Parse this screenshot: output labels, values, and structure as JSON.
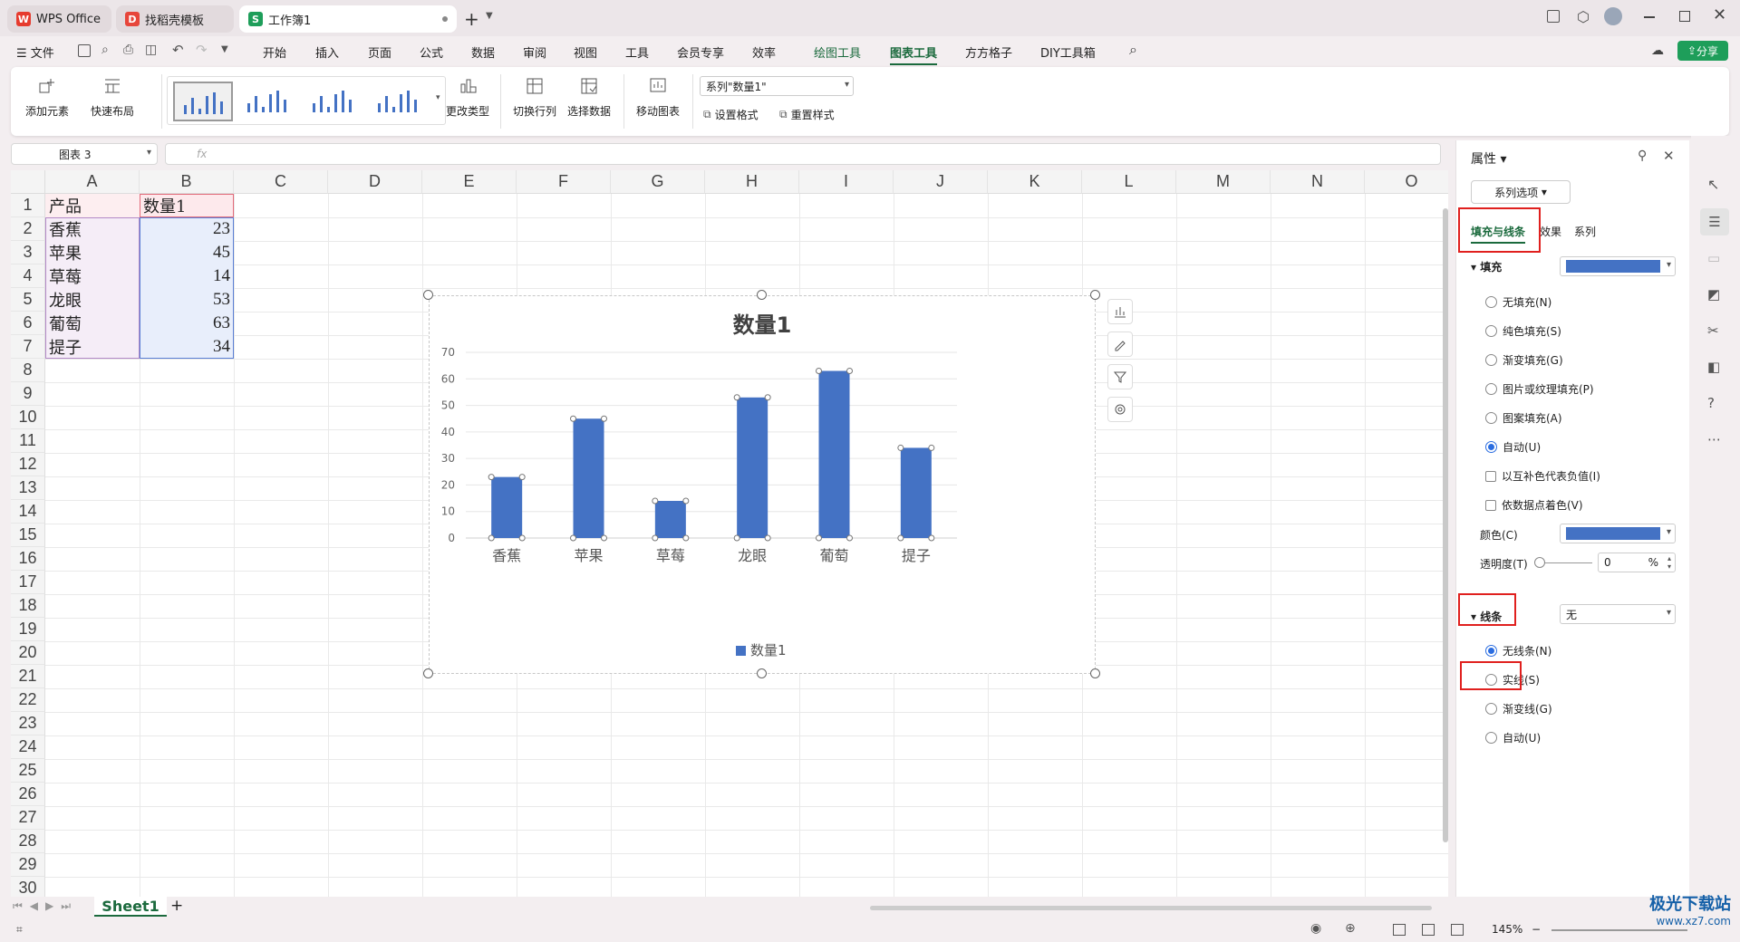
{
  "tabs": [
    {
      "label": "WPS Office",
      "logo": "W"
    },
    {
      "label": "找稻壳模板",
      "logo": "D"
    },
    {
      "label": "工作簿1",
      "logo": "S"
    }
  ],
  "menu": {
    "file": "文件",
    "items": [
      "开始",
      "插入",
      "页面",
      "公式",
      "数据",
      "审阅",
      "视图",
      "工具",
      "会员专享",
      "效率",
      "绘图工具",
      "图表工具",
      "方方格子",
      "DIY工具箱"
    ],
    "share": "分享"
  },
  "ribbon": {
    "add_element": "添加元素",
    "quick_layout": "快速布局",
    "change_type": "更改类型",
    "switch_row_col": "切换行列",
    "select_data": "选择数据",
    "move_chart": "移动图表",
    "series_select": "系列\"数量1\"",
    "set_format": "设置格式",
    "reset_style": "重置样式"
  },
  "name_box": "图表 3",
  "formula_fx": "fx",
  "columns": [
    "A",
    "B",
    "C",
    "D",
    "E",
    "F",
    "G",
    "H",
    "I",
    "J",
    "K",
    "L",
    "M",
    "N",
    "O"
  ],
  "rows": [
    "1",
    "2",
    "3",
    "4",
    "5",
    "6",
    "7",
    "8",
    "9",
    "10",
    "11",
    "12",
    "13",
    "14",
    "15",
    "16",
    "17",
    "18",
    "19",
    "20",
    "21",
    "22",
    "23",
    "24",
    "25",
    "26",
    "27",
    "28",
    "29",
    "30"
  ],
  "cells": {
    "header": [
      "产品",
      "数量1"
    ],
    "data": [
      [
        "香蕉",
        "23"
      ],
      [
        "苹果",
        "45"
      ],
      [
        "草莓",
        "14"
      ],
      [
        "龙眼",
        "53"
      ],
      [
        "葡萄",
        "63"
      ],
      [
        "提子",
        "34"
      ]
    ]
  },
  "chart_data": {
    "type": "bar",
    "title": "数量1",
    "categories": [
      "香蕉",
      "苹果",
      "草莓",
      "龙眼",
      "葡萄",
      "提子"
    ],
    "series": [
      {
        "name": "数量1",
        "values": [
          23,
          45,
          14,
          53,
          63,
          34
        ],
        "color": "#4472c4"
      }
    ],
    "ylim": [
      0,
      70
    ],
    "yticks": [
      "0",
      "10",
      "20",
      "30",
      "40",
      "50",
      "60",
      "70"
    ],
    "legend": "bottom",
    "grid": true
  },
  "sheet_tab": "Sheet1",
  "status": {
    "zoom": "145%"
  },
  "panel": {
    "title": "属性",
    "series_options": "系列选项",
    "tabs": [
      "填充与线条",
      "效果",
      "系列"
    ],
    "fill_heading": "填充",
    "fill_options": [
      "无填充(N)",
      "纯色填充(S)",
      "渐变填充(G)",
      "图片或纹理填充(P)",
      "图案填充(A)",
      "自动(U)"
    ],
    "invert_negative": "以互补色代表负值(I)",
    "vary_colors": "依数据点着色(V)",
    "color_label": "颜色(C)",
    "transparency_label": "透明度(T)",
    "transparency_value": "0",
    "percent": "%",
    "line_heading": "线条",
    "line_value": "无",
    "line_options": [
      "无线条(N)",
      "实线(S)",
      "渐变线(G)",
      "自动(U)"
    ],
    "fill_color": "#4472c4"
  },
  "watermark": "极光下载站",
  "watermark_url": "www.xz7.com"
}
